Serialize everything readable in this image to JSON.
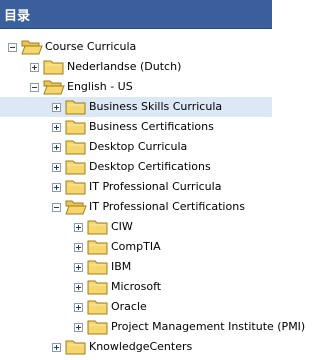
{
  "header": {
    "title": "目录"
  },
  "tree": {
    "nodes": [
      {
        "label": "Course Curricula",
        "state": "expanded",
        "level": 0,
        "icon": "folder-open-icon"
      },
      {
        "label": "Nederlandse (Dutch)",
        "state": "collapsed",
        "level": 1,
        "icon": "folder-icon"
      },
      {
        "label": "English - US",
        "state": "expanded",
        "level": 1,
        "icon": "folder-open-icon"
      },
      {
        "label": "Business Skills Curricula",
        "state": "collapsed",
        "level": 2,
        "icon": "folder-icon",
        "selected": true
      },
      {
        "label": "Business Certifications",
        "state": "collapsed",
        "level": 2,
        "icon": "folder-icon"
      },
      {
        "label": "Desktop Curricula",
        "state": "collapsed",
        "level": 2,
        "icon": "folder-icon"
      },
      {
        "label": "Desktop Certifications",
        "state": "collapsed",
        "level": 2,
        "icon": "folder-icon"
      },
      {
        "label": "IT Professional Curricula",
        "state": "collapsed",
        "level": 2,
        "icon": "folder-icon"
      },
      {
        "label": "IT Professional Certifications",
        "state": "expanded",
        "level": 2,
        "icon": "folder-open-icon"
      },
      {
        "label": "CIW",
        "state": "collapsed",
        "level": 3,
        "icon": "folder-icon"
      },
      {
        "label": "CompTIA",
        "state": "collapsed",
        "level": 3,
        "icon": "folder-icon"
      },
      {
        "label": "IBM",
        "state": "collapsed",
        "level": 3,
        "icon": "folder-icon"
      },
      {
        "label": "Microsoft",
        "state": "collapsed",
        "level": 3,
        "icon": "folder-icon"
      },
      {
        "label": "Oracle",
        "state": "collapsed",
        "level": 3,
        "icon": "folder-icon"
      },
      {
        "label": "Project Management Institute (PMI)",
        "state": "collapsed",
        "level": 3,
        "icon": "folder-icon"
      },
      {
        "label": "KnowledgeCenters",
        "state": "collapsed",
        "level": 2,
        "icon": "folder-icon"
      }
    ]
  },
  "colors": {
    "header_bg": "#3b5f9c",
    "selected_bg": "#dde8f7",
    "folder_fill": "#f5d76e",
    "folder_stroke": "#a07d1c",
    "toggle_border": "#8c9bb0"
  }
}
